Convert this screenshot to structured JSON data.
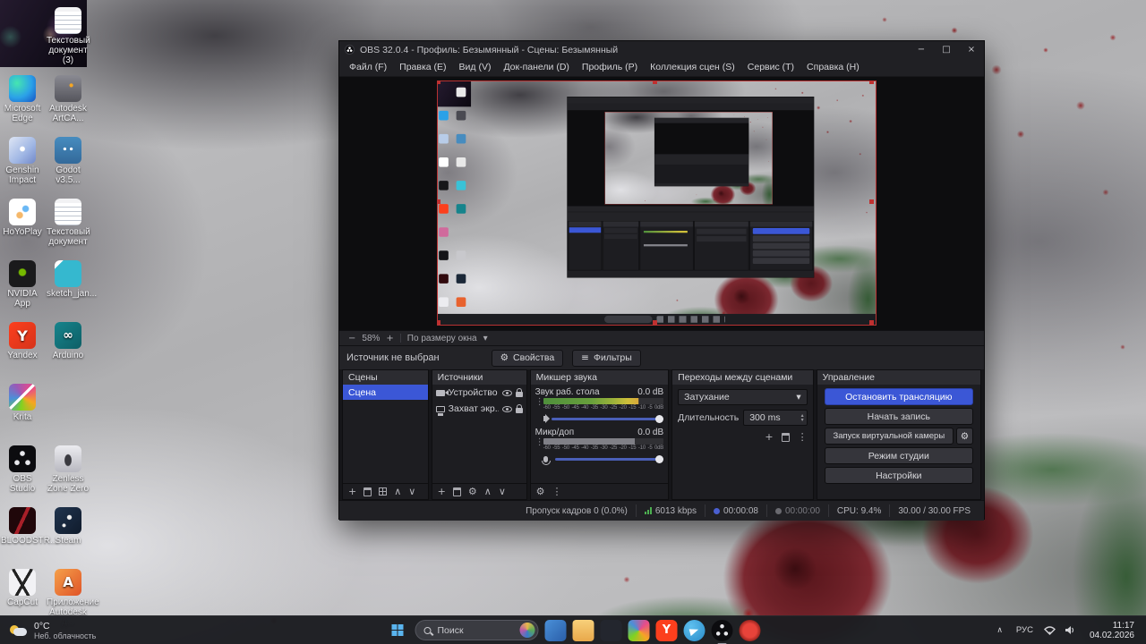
{
  "colors": {
    "accent": "#3b57d6",
    "window_bg": "#202024",
    "panel_bg": "#1d1d21",
    "dock_header_bg": "#2c2c31",
    "taskbar_bg": "#1c1d21",
    "meter_green": "#4f8f3c",
    "meter_yellow": "#cdbf3a",
    "meter_orange": "#d9a93a",
    "bitrate_green": "#4caf50",
    "selection_red": "#b83232"
  },
  "icons": {
    "minimize": "−",
    "maximize": "□",
    "close": "×",
    "caret_down": "▾",
    "kebab": "⋮",
    "up": "▴",
    "down": "▾",
    "chevron_up": "∧",
    "chevron_down": "∨",
    "plus": "+",
    "minus": "−",
    "gear": "⚙",
    "filters": "≡"
  },
  "desktop": {
    "icons": [
      {
        "label": "Microsoft Edge",
        "glyph": ""
      },
      {
        "label": "Genshin Impact",
        "glyph": ""
      },
      {
        "label": "HoYoPlay",
        "glyph": ""
      },
      {
        "label": "NVIDIA App",
        "glyph": ""
      },
      {
        "label": "Yandex",
        "glyph": "Y"
      },
      {
        "label": "Krita",
        "glyph": ""
      },
      {
        "label": "OBS Studio",
        "glyph": ""
      },
      {
        "label": "BLOODSTR...",
        "glyph": ""
      },
      {
        "label": "CapCut",
        "glyph": ""
      },
      {
        "label": "Текстовый документ (3)",
        "glyph": ""
      },
      {
        "label": "Autodesk ArtCA...",
        "glyph": ""
      },
      {
        "label": "Godot v3.5...",
        "glyph": ""
      },
      {
        "label": "Текстовый документ",
        "glyph": ""
      },
      {
        "label": "sketch_jan...",
        "glyph": ""
      },
      {
        "label": "Arduino",
        "glyph": "∞"
      },
      {
        "label": "Zenless Zone Zero",
        "glyph": ""
      },
      {
        "label": "Steam",
        "glyph": ""
      },
      {
        "label": "Приложение Autodesk д...",
        "glyph": "A"
      }
    ]
  },
  "taskbar": {
    "weather": {
      "temp": "0°C",
      "condition": "Неб. облачность"
    },
    "search_placeholder": "Поиск",
    "yandex_glyph": "Y",
    "app_icons": [
      "windows-start-icon",
      "search-icon",
      "blue-app-icon",
      "file-explorer-icon",
      "dark-app-icon",
      "krita-icon",
      "yandex-browser-icon",
      "telegram-icon",
      "obs-studio-icon",
      "record-indicator-icon"
    ],
    "tray": {
      "language": "РУС",
      "time": "11:17",
      "date": "04.02.2026"
    }
  },
  "obs": {
    "title": "OBS 32.0.4 - Профиль: Безымянный - Сцены: Безымянный",
    "menu": [
      "Файл (F)",
      "Правка (E)",
      "Вид (V)",
      "Док-панели (D)",
      "Профиль (P)",
      "Коллекция сцен (S)",
      "Сервис (T)",
      "Справка (H)"
    ],
    "preview": {
      "zoom": "58%",
      "fit_mode": "По размеру окна"
    },
    "source_toolbar": {
      "no_source": "Источник не выбран",
      "properties": "Свойства",
      "filters": "Фильтры"
    },
    "scenes": {
      "title": "Сцены",
      "items": [
        "Сцена"
      ]
    },
    "sources": {
      "title": "Источники",
      "items": [
        {
          "label": "Устройство"
        },
        {
          "label": "Захват экр..."
        }
      ]
    },
    "mixer": {
      "title": "Микшер звука",
      "channels": [
        {
          "name": "Звук раб. стола",
          "level": "0.0 dB"
        },
        {
          "name": "Микр/доп",
          "level": "0.0 dB"
        }
      ],
      "scale": [
        "-60",
        "-55",
        "-50",
        "-45",
        "-40",
        "-35",
        "-30",
        "-25",
        "-20",
        "-15",
        "-10",
        "-5",
        "0dB"
      ]
    },
    "transitions": {
      "title": "Переходы между сценами",
      "selected": "Затухание",
      "duration_label": "Длительность",
      "duration_value": "300 ms"
    },
    "controls": {
      "title": "Управление",
      "stop_stream": "Остановить трансляцию",
      "start_record": "Начать запись",
      "virtual_camera": "Запуск виртуальной камеры",
      "studio_mode": "Режим студии",
      "settings": "Настройки"
    },
    "status": {
      "dropped_frames": "Пропуск кадров 0 (0.0%)",
      "bitrate": "6013 kbps",
      "stream_time": "00:00:08",
      "record_time": "00:00:00",
      "cpu": "CPU: 9.4%",
      "fps": "30.00 / 30.00 FPS"
    }
  }
}
